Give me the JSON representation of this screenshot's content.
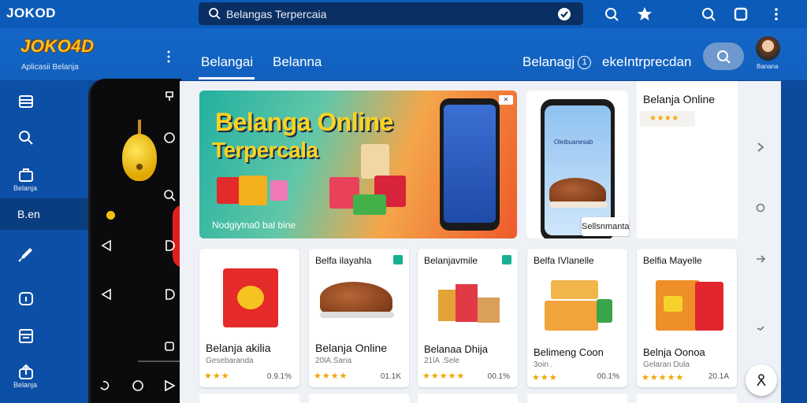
{
  "topbar": {
    "title": "JOKOD",
    "search_text": "Belangas Terpercaia",
    "icons": [
      "search-icon",
      "badge-icon",
      "search-icon",
      "star-icon",
      "search-icon",
      "square-icon",
      "kebab-menu-icon"
    ]
  },
  "header": {
    "logo": "JOKO4D",
    "logo_sub": "Aplicasii Belanja",
    "tabs": [
      "Belangai",
      "Belanna"
    ],
    "link1": "Belanagj",
    "link1_badge": "1",
    "link2": "ekeIntrprecdan",
    "avatar_name": "Banana"
  },
  "sidebar": {
    "items": [
      {
        "icon": "list-icon",
        "label": ""
      },
      {
        "icon": "search-icon",
        "label": ""
      },
      {
        "icon": "cart-icon",
        "label": "Belanja"
      },
      {
        "icon": "",
        "label": "B.en"
      },
      {
        "icon": "tag-icon",
        "label": ""
      },
      {
        "icon": "info-icon",
        "label": ""
      },
      {
        "icon": "grid-icon",
        "label": ""
      },
      {
        "icon": "upload-icon",
        "label": "Belanja"
      }
    ]
  },
  "banner": {
    "title_line1": "Belanga Online",
    "title_line2": "Terpercala",
    "subtitle": "Nodgiytna0 bal bine",
    "badge": "✕"
  },
  "promo2": {
    "screen_title": "Oleibuanesab",
    "chip": "Sellsnmanta"
  },
  "right_card": {
    "title": "Belanja Online",
    "rating": "★★★★"
  },
  "products": [
    {
      "title": "",
      "name": "Belanja akilia",
      "sub": "Gesebaranda",
      "stars": "★★★",
      "value": "0.9.1%"
    },
    {
      "title": "Belfa ilayahla",
      "name": "Belanja Online",
      "sub": "20lA.Sana",
      "stars": "★★★★",
      "value": "01.1K"
    },
    {
      "title": "Belanjavmile",
      "name": "Belanaa Dhija",
      "sub": "21lA .Sele",
      "stars": "★★★★★",
      "value": "00.1%"
    },
    {
      "title": "Belfa IVlanelle",
      "name": "Belimeng Coon",
      "sub": "3oin .",
      "stars": "★★★",
      "value": "00.1%"
    },
    {
      "title": "Belfia Mayelle",
      "name": "Belnja Oonoa",
      "sub": "Gelaran Dula",
      "stars": "★★★★★",
      "value": "20.1A"
    }
  ],
  "colors": {
    "brand_blue": "#0d5bb8",
    "accent_yellow": "#f6c321",
    "star": "#f0a500",
    "tag_green": "#16b08f"
  }
}
